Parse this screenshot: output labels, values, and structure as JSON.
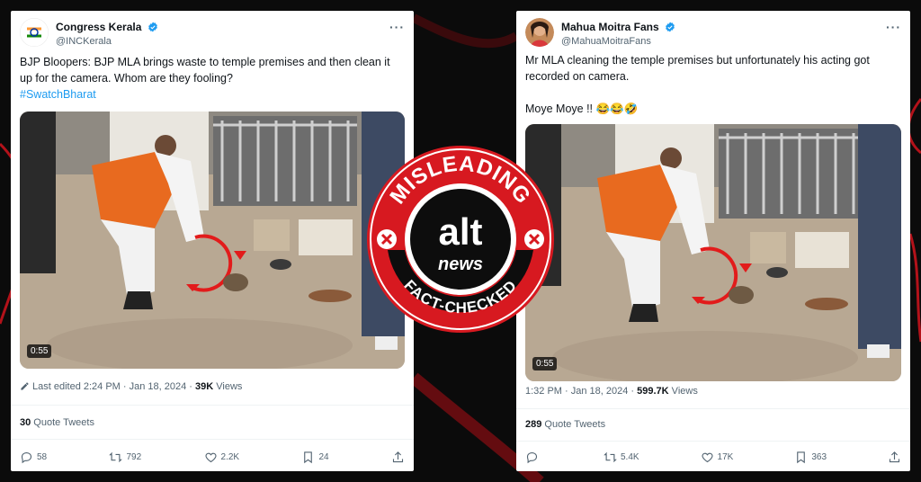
{
  "left_tweet": {
    "author_name": "Congress Kerala",
    "author_handle": "@INCKerala",
    "text": "BJP Bloopers: BJP MLA brings waste to temple premises and then clean it up for the camera. Whom are they fooling?",
    "hashtag": "#SwatchBharat",
    "video_duration": "0:55",
    "edited_label": "Last edited 2:24 PM · Jan 18, 2024 · ",
    "views_count": "39K",
    "views_label": " Views",
    "quote_count": "30",
    "quote_label": " Quote Tweets",
    "replies": "58",
    "retweets": "792",
    "likes": "2.2K",
    "bookmarks": "24"
  },
  "right_tweet": {
    "author_name": "Mahua Moitra Fans",
    "author_handle": "@MahuaMoitraFans",
    "text": "Mr MLA cleaning the temple premises but unfortunately his acting got recorded on camera.",
    "text2": "Moye Moye !! 😂😂🤣",
    "video_duration": "0:55",
    "timestamp": "1:32 PM · Jan 18, 2024 · ",
    "views_count": "599.7K",
    "views_label": " Views",
    "quote_count": "289",
    "quote_label": " Quote Tweets",
    "replies": "",
    "retweets": "5.4K",
    "likes": "17K",
    "bookmarks": "363"
  },
  "badge": {
    "top_text": "MISLEADING",
    "brand_main": "alt",
    "brand_sub": "news",
    "bottom_text": "FACT-CHECKED"
  },
  "colors": {
    "badge_red": "#d71920",
    "verified_blue": "#1d9bf0",
    "background": "#0b0b0b"
  }
}
